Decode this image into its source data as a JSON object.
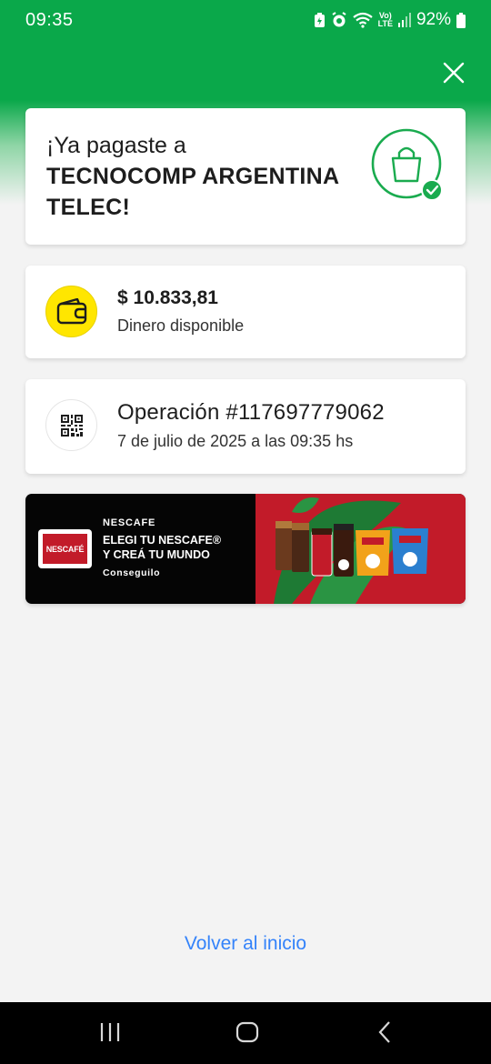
{
  "status_bar": {
    "time": "09:35",
    "battery_percent": "92%",
    "icons": [
      "battery-saver-icon",
      "alarm-icon",
      "wifi-icon",
      "volte-icon",
      "signal-icon",
      "battery-icon"
    ],
    "volte_label_top": "Vo)",
    "volte_label_bottom": "LTE"
  },
  "header": {
    "close_icon": "close-icon",
    "background_color": "#0aa84a"
  },
  "payment": {
    "message_prefix": "¡Ya pagaste a",
    "merchant_line1": "TECNOCOMP ARGENTINA",
    "merchant_line2": "TELEC!",
    "icon": "shopping-bag-check-icon",
    "accent_color": "#1aab4f"
  },
  "balance": {
    "amount": "$ 10.833,81",
    "label": "Dinero disponible",
    "icon": "wallet-icon"
  },
  "operation": {
    "title": "Operación #117697779062",
    "date": "7 de julio de 2025 a las 09:35 hs",
    "icon": "qr-code-icon"
  },
  "ad": {
    "logo_text": "NESCAFÉ",
    "brand": "NESCAFE",
    "headline_line1": "ELEGI TU NESCAFE®",
    "headline_line2": "Y CREÁ TU MUNDO",
    "cta": "Conseguilo"
  },
  "footer": {
    "back_home_label": "Volver al inicio",
    "link_color": "#3483fa"
  },
  "nav": {
    "icons": [
      "recent-apps-icon",
      "home-icon",
      "back-icon"
    ]
  }
}
